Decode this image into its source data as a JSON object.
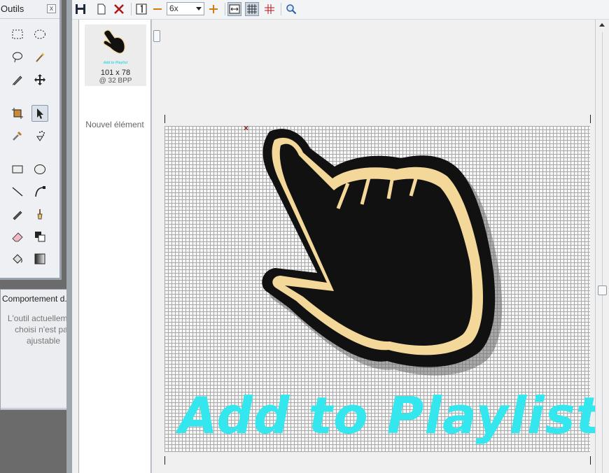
{
  "tools_panel": {
    "title": "Outils",
    "close_label": "x",
    "tools": [
      {
        "name": "rect-select",
        "icon": "rect-select-icon"
      },
      {
        "name": "ellipse-select",
        "icon": "ellipse-select-icon"
      },
      {
        "name": "lasso",
        "icon": "lasso-icon"
      },
      {
        "name": "magic-wand",
        "icon": "magic-wand-icon"
      },
      {
        "name": "pen-select",
        "icon": "pen-select-icon"
      },
      {
        "name": "move",
        "icon": "move-icon"
      },
      {
        "name": "crop",
        "icon": "crop-icon"
      },
      {
        "name": "pointer",
        "icon": "pointer-icon",
        "selected": true
      },
      {
        "name": "eyedropper",
        "icon": "eyedropper-icon"
      },
      {
        "name": "spray",
        "icon": "spray-icon"
      },
      {
        "name": "rectangle",
        "icon": "rectangle-icon"
      },
      {
        "name": "ellipse",
        "icon": "ellipse-icon"
      },
      {
        "name": "line",
        "icon": "line-icon"
      },
      {
        "name": "curve",
        "icon": "curve-icon"
      },
      {
        "name": "pencil",
        "icon": "pencil-icon"
      },
      {
        "name": "brush",
        "icon": "brush-icon"
      },
      {
        "name": "eraser",
        "icon": "eraser-icon"
      },
      {
        "name": "color-replace",
        "icon": "color-replace-icon"
      },
      {
        "name": "fill",
        "icon": "fill-icon"
      },
      {
        "name": "gradient",
        "icon": "gradient-icon"
      }
    ]
  },
  "behavior_panel": {
    "title": "Comportement d...",
    "message": "L'outil actuellement choisi n'est pas ajustable"
  },
  "toolbar": {
    "zoom_value": "6x",
    "buttons": [
      "save-icon",
      "new-image-icon",
      "delete-icon",
      "actual-size-icon",
      "zoom-out-icon",
      "zoom-in-icon",
      "fit-icon",
      "grid-icon",
      "hotspot-icon",
      "magnifier-icon"
    ]
  },
  "image_list": {
    "items": [
      {
        "caption": "Add to Playlist",
        "dimensions": "101 x 78",
        "bpp": "@ 32 BPP"
      }
    ],
    "new_item_label": "Nouvel élément"
  },
  "canvas": {
    "hotspot_marker": "×",
    "image_text": "Add to Playlist",
    "colors": {
      "hand_fill": "#111111",
      "hand_outline": "#f3d89a",
      "shadow": "#6a6a6a",
      "text": "#34e6ee"
    }
  }
}
